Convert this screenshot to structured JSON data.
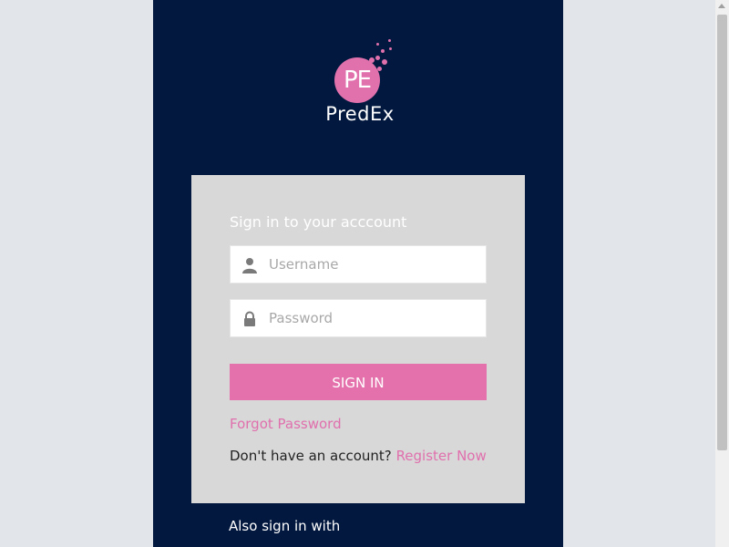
{
  "brand": {
    "mark": "PE",
    "name": "PredEx",
    "accent_color": "#e071ad",
    "panel_color": "#02183f"
  },
  "login": {
    "title": "Sign in to your acccount",
    "username": {
      "placeholder": "Username",
      "value": "",
      "icon": "user-icon"
    },
    "password": {
      "placeholder": "Password",
      "value": "",
      "icon": "lock-icon"
    },
    "submit_label": "SIGN IN",
    "forgot_label": "Forgot Password",
    "no_account_text": "Don't have an account?",
    "register_label": "Register Now"
  },
  "social": {
    "heading": "Also sign in with"
  }
}
